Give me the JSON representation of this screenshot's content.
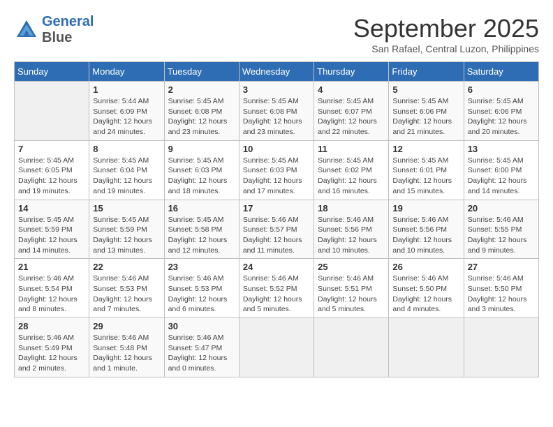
{
  "header": {
    "logo_line1": "General",
    "logo_line2": "Blue",
    "month": "September 2025",
    "location": "San Rafael, Central Luzon, Philippines"
  },
  "days_of_week": [
    "Sunday",
    "Monday",
    "Tuesday",
    "Wednesday",
    "Thursday",
    "Friday",
    "Saturday"
  ],
  "weeks": [
    [
      {
        "num": "",
        "info": ""
      },
      {
        "num": "1",
        "info": "Sunrise: 5:44 AM\nSunset: 6:09 PM\nDaylight: 12 hours\nand 24 minutes."
      },
      {
        "num": "2",
        "info": "Sunrise: 5:45 AM\nSunset: 6:08 PM\nDaylight: 12 hours\nand 23 minutes."
      },
      {
        "num": "3",
        "info": "Sunrise: 5:45 AM\nSunset: 6:08 PM\nDaylight: 12 hours\nand 23 minutes."
      },
      {
        "num": "4",
        "info": "Sunrise: 5:45 AM\nSunset: 6:07 PM\nDaylight: 12 hours\nand 22 minutes."
      },
      {
        "num": "5",
        "info": "Sunrise: 5:45 AM\nSunset: 6:06 PM\nDaylight: 12 hours\nand 21 minutes."
      },
      {
        "num": "6",
        "info": "Sunrise: 5:45 AM\nSunset: 6:06 PM\nDaylight: 12 hours\nand 20 minutes."
      }
    ],
    [
      {
        "num": "7",
        "info": "Sunrise: 5:45 AM\nSunset: 6:05 PM\nDaylight: 12 hours\nand 19 minutes."
      },
      {
        "num": "8",
        "info": "Sunrise: 5:45 AM\nSunset: 6:04 PM\nDaylight: 12 hours\nand 19 minutes."
      },
      {
        "num": "9",
        "info": "Sunrise: 5:45 AM\nSunset: 6:03 PM\nDaylight: 12 hours\nand 18 minutes."
      },
      {
        "num": "10",
        "info": "Sunrise: 5:45 AM\nSunset: 6:03 PM\nDaylight: 12 hours\nand 17 minutes."
      },
      {
        "num": "11",
        "info": "Sunrise: 5:45 AM\nSunset: 6:02 PM\nDaylight: 12 hours\nand 16 minutes."
      },
      {
        "num": "12",
        "info": "Sunrise: 5:45 AM\nSunset: 6:01 PM\nDaylight: 12 hours\nand 15 minutes."
      },
      {
        "num": "13",
        "info": "Sunrise: 5:45 AM\nSunset: 6:00 PM\nDaylight: 12 hours\nand 14 minutes."
      }
    ],
    [
      {
        "num": "14",
        "info": "Sunrise: 5:45 AM\nSunset: 5:59 PM\nDaylight: 12 hours\nand 14 minutes."
      },
      {
        "num": "15",
        "info": "Sunrise: 5:45 AM\nSunset: 5:59 PM\nDaylight: 12 hours\nand 13 minutes."
      },
      {
        "num": "16",
        "info": "Sunrise: 5:45 AM\nSunset: 5:58 PM\nDaylight: 12 hours\nand 12 minutes."
      },
      {
        "num": "17",
        "info": "Sunrise: 5:46 AM\nSunset: 5:57 PM\nDaylight: 12 hours\nand 11 minutes."
      },
      {
        "num": "18",
        "info": "Sunrise: 5:46 AM\nSunset: 5:56 PM\nDaylight: 12 hours\nand 10 minutes."
      },
      {
        "num": "19",
        "info": "Sunrise: 5:46 AM\nSunset: 5:56 PM\nDaylight: 12 hours\nand 10 minutes."
      },
      {
        "num": "20",
        "info": "Sunrise: 5:46 AM\nSunset: 5:55 PM\nDaylight: 12 hours\nand 9 minutes."
      }
    ],
    [
      {
        "num": "21",
        "info": "Sunrise: 5:46 AM\nSunset: 5:54 PM\nDaylight: 12 hours\nand 8 minutes."
      },
      {
        "num": "22",
        "info": "Sunrise: 5:46 AM\nSunset: 5:53 PM\nDaylight: 12 hours\nand 7 minutes."
      },
      {
        "num": "23",
        "info": "Sunrise: 5:46 AM\nSunset: 5:53 PM\nDaylight: 12 hours\nand 6 minutes."
      },
      {
        "num": "24",
        "info": "Sunrise: 5:46 AM\nSunset: 5:52 PM\nDaylight: 12 hours\nand 5 minutes."
      },
      {
        "num": "25",
        "info": "Sunrise: 5:46 AM\nSunset: 5:51 PM\nDaylight: 12 hours\nand 5 minutes."
      },
      {
        "num": "26",
        "info": "Sunrise: 5:46 AM\nSunset: 5:50 PM\nDaylight: 12 hours\nand 4 minutes."
      },
      {
        "num": "27",
        "info": "Sunrise: 5:46 AM\nSunset: 5:50 PM\nDaylight: 12 hours\nand 3 minutes."
      }
    ],
    [
      {
        "num": "28",
        "info": "Sunrise: 5:46 AM\nSunset: 5:49 PM\nDaylight: 12 hours\nand 2 minutes."
      },
      {
        "num": "29",
        "info": "Sunrise: 5:46 AM\nSunset: 5:48 PM\nDaylight: 12 hours\nand 1 minute."
      },
      {
        "num": "30",
        "info": "Sunrise: 5:46 AM\nSunset: 5:47 PM\nDaylight: 12 hours\nand 0 minutes."
      },
      {
        "num": "",
        "info": ""
      },
      {
        "num": "",
        "info": ""
      },
      {
        "num": "",
        "info": ""
      },
      {
        "num": "",
        "info": ""
      }
    ]
  ]
}
